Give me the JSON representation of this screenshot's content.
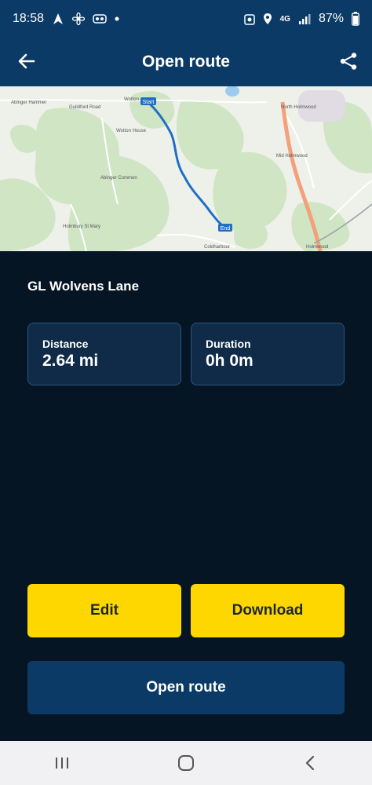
{
  "status_bar": {
    "time": "18:58",
    "network": "4G",
    "battery": "87%"
  },
  "app_bar": {
    "title": "Open route",
    "back_icon": "arrow-left-icon",
    "share_icon": "share-icon"
  },
  "map": {
    "labels": {
      "wotton": "Wotton",
      "abinger_hammer": "Abinger Hammer",
      "guildford_road": "Guildford Road",
      "wotton_house": "Wotton House",
      "abinger_common": "Abinger Common",
      "holmbury": "Holmbury St Mary",
      "north_holmwood": "North Holmwood",
      "mid_holmwood": "Mid Holmwood",
      "holmwood": "Holmwood",
      "coldharbour": "Coldharbour",
      "start_marker": "Start",
      "end_marker": "End"
    },
    "colors": {
      "route": "#1f6fc4",
      "road_major": "#f4a07a",
      "forest": "#cfe5c3",
      "water": "#9ccbef"
    }
  },
  "route": {
    "name": "GL Wolvens Lane",
    "distance_label": "Distance",
    "distance_value": "2.64 mi",
    "duration_label": "Duration",
    "duration_value": "0h 0m"
  },
  "actions": {
    "edit": "Edit",
    "download": "Download",
    "open_route": "Open route"
  },
  "colors": {
    "background": "#061523",
    "header": "#0b3a66",
    "accent_yellow": "#ffd700",
    "card": "#0f2b47"
  }
}
